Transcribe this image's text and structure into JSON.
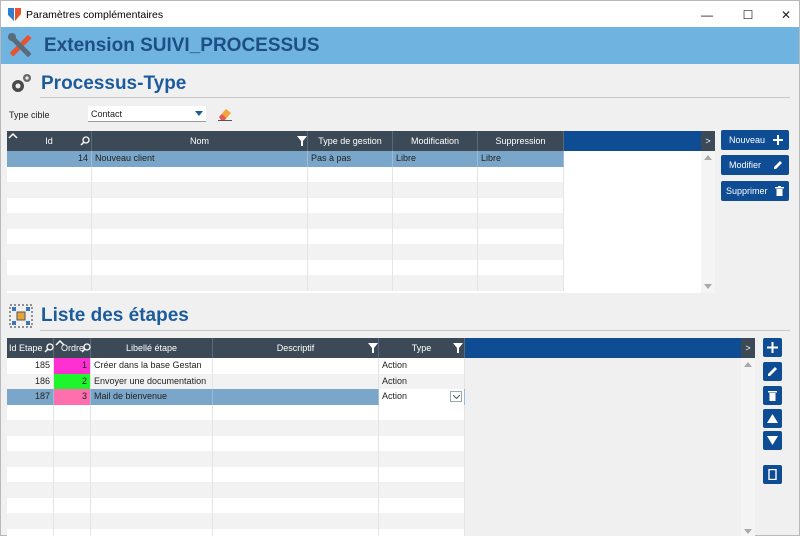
{
  "window": {
    "title": "Paramètres complémentaires"
  },
  "banner": {
    "title": "Extension SUIVI_PROCESSUS"
  },
  "section1": {
    "title": "Processus-Type",
    "type_label": "Type cible",
    "type_value": "Contact",
    "columns": [
      "Id",
      "Nom",
      "Type de gestion",
      "Modification",
      "Suppression"
    ],
    "rows": [
      {
        "id": "14",
        "nom": "Nouveau client",
        "gestion": "Pas à pas",
        "modification": "Libre",
        "suppression": "Libre"
      }
    ],
    "buttons": {
      "new": "Nouveau",
      "edit": "Modifier",
      "delete": "Supprimer"
    }
  },
  "section2": {
    "title": "Liste des étapes",
    "columns": [
      "Id Etape",
      "Ordre",
      "Libellé étape",
      "Descriptif",
      "Type"
    ],
    "rows": [
      {
        "id": "185",
        "ordre": "1",
        "libelle": "Créer dans la base Gestan",
        "descriptif": "",
        "type": "Action",
        "color": "#ff2fd2"
      },
      {
        "id": "186",
        "ordre": "2",
        "libelle": "Envoyer une documentation",
        "descriptif": "",
        "type": "Action",
        "color": "#1ff52b"
      },
      {
        "id": "187",
        "ordre": "3",
        "libelle": "Mail de bienvenue",
        "descriptif": "",
        "type": "Action",
        "color": "#ff6fae"
      }
    ]
  },
  "colors": {
    "accent": "#0e4d93",
    "banner": "#6fb3e0",
    "header": "#3b4a56",
    "selected": "#7aa6c9"
  }
}
